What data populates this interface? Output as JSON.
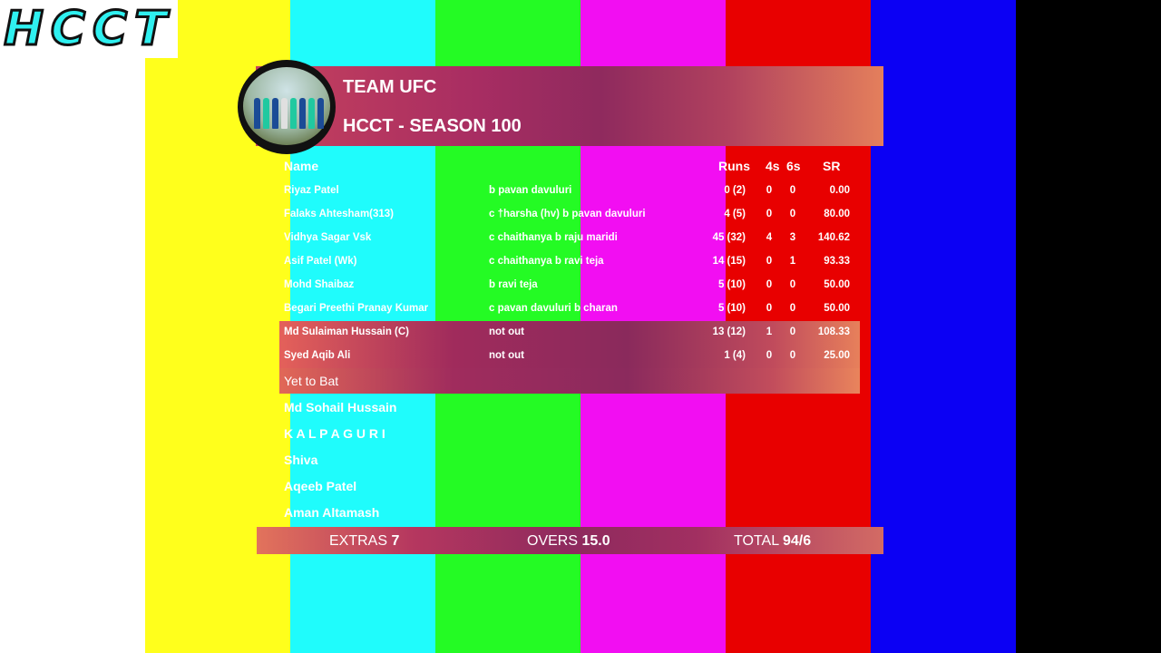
{
  "logo": {
    "text": "HCCT"
  },
  "background_colors": [
    "#ffff1c",
    "#1ffcfc",
    "#24fb24",
    "#f20ef2",
    "#e80000",
    "#0b00f4",
    "#000000"
  ],
  "header": {
    "team": "TEAM UFC",
    "season": "HCCT - SEASON 100",
    "photo": "team-photo"
  },
  "columns": {
    "name": "Name",
    "runs": "Runs",
    "fours": "4s",
    "sixes": "6s",
    "sr": "SR"
  },
  "batting": [
    {
      "name": "Riyaz Patel",
      "dismissal": "b pavan davuluri",
      "runs": "0 (2)",
      "fours": "0",
      "sixes": "0",
      "sr": "0.00"
    },
    {
      "name": "Falaks Ahtesham(313)",
      "dismissal": "c †harsha (hv) b pavan davuluri",
      "runs": "4 (5)",
      "fours": "0",
      "sixes": "0",
      "sr": "80.00"
    },
    {
      "name": "Vidhya Sagar Vsk",
      "dismissal": "c chaithanya b raju maridi",
      "runs": "45 (32)",
      "fours": "4",
      "sixes": "3",
      "sr": "140.62"
    },
    {
      "name": "Asif Patel (Wk)",
      "dismissal": "c chaithanya b ravi teja",
      "runs": "14 (15)",
      "fours": "0",
      "sixes": "1",
      "sr": "93.33"
    },
    {
      "name": "Mohd Shaibaz",
      "dismissal": "b ravi teja",
      "runs": "5 (10)",
      "fours": "0",
      "sixes": "0",
      "sr": "50.00"
    },
    {
      "name": "Begari Preethi Pranay Kumar",
      "dismissal": "c pavan davuluri b charan",
      "runs": "5 (10)",
      "fours": "0",
      "sixes": "0",
      "sr": "50.00"
    },
    {
      "name": "Md Sulaiman Hussain (C)",
      "dismissal": "not out",
      "runs": "13 (12)",
      "fours": "1",
      "sixes": "0",
      "sr": "108.33"
    },
    {
      "name": "Syed Aqib Ali",
      "dismissal": "not out",
      "runs": "1 (4)",
      "fours": "0",
      "sixes": "0",
      "sr": "25.00"
    }
  ],
  "yet_to_bat": {
    "label": "Yet to Bat",
    "players": [
      "Md Sohail Hussain",
      "K A L P A G U R I",
      "Shiva",
      "Aqeeb Patel",
      "Aman Altamash"
    ]
  },
  "footer": {
    "extras_label": "EXTRAS",
    "extras_value": "7",
    "overs_label": "OVERS",
    "overs_value": "15.0",
    "total_label": "TOTAL",
    "total_value": "94/6"
  }
}
